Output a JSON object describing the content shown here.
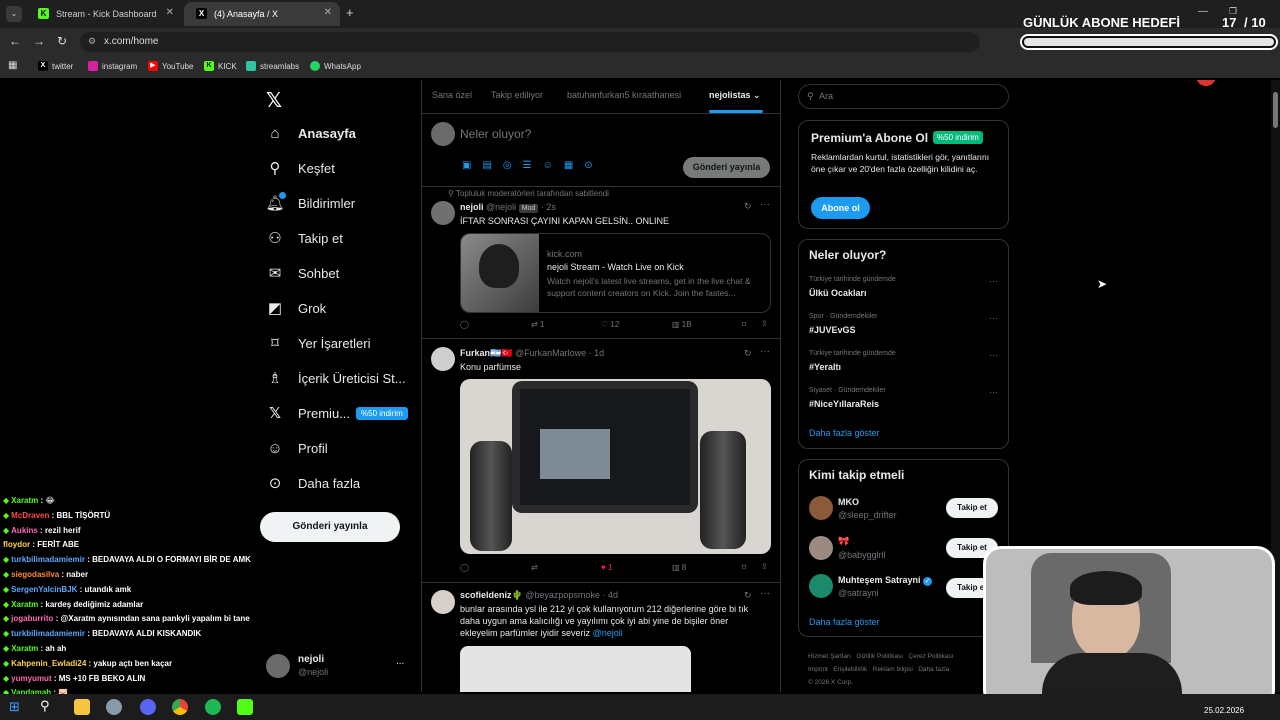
{
  "browser": {
    "tabs": [
      {
        "label": "Stream - Kick Dashboard",
        "favicon": "K",
        "active": false
      },
      {
        "label": "(4) Anasayfa / X",
        "favicon": "X",
        "active": true
      }
    ],
    "new_tab": "+",
    "url": "x.com/home",
    "bookmarks": [
      {
        "label": "twitter",
        "icon": "x-icon"
      },
      {
        "label": "instagram",
        "icon": "instagram-icon"
      },
      {
        "label": "YouTube",
        "icon": "youtube-icon"
      },
      {
        "label": "KICK",
        "icon": "kick-icon"
      },
      {
        "label": "streamlabs",
        "icon": "streamlabs-icon"
      },
      {
        "label": "WhatsApp",
        "icon": "whatsapp-icon"
      }
    ]
  },
  "overlay": {
    "goal_title": "GÜNLÜK ABONE HEDEFİ",
    "goal_current": "17",
    "goal_total": "/ 10",
    "goal_progress": 1.0
  },
  "sidebar": {
    "items": [
      {
        "label": "Anasayfa",
        "icon": "home-icon",
        "active": true
      },
      {
        "label": "Keşfet",
        "icon": "search-icon"
      },
      {
        "label": "Bildirimler",
        "icon": "bell-icon"
      },
      {
        "label": "Takip et",
        "icon": "add-user-icon"
      },
      {
        "label": "Sohbet",
        "icon": "mail-icon"
      },
      {
        "label": "Grok",
        "icon": "grok-icon"
      },
      {
        "label": "Yer İşaretleri",
        "icon": "bookmark-icon"
      },
      {
        "label": "İçerik Üreticisi St...",
        "icon": "creator-icon"
      },
      {
        "label": "Premiu...",
        "icon": "x-icon",
        "badge": "%50 indirim"
      },
      {
        "label": "Profil",
        "icon": "person-icon"
      },
      {
        "label": "Daha fazla",
        "icon": "more-icon"
      }
    ],
    "post_button": "Gönderi yayınla",
    "account_name": "nejoli",
    "account_handle": "@nejoli",
    "account_more": "..."
  },
  "feed": {
    "tabs": [
      "Sana özel",
      "Takip ediliyor",
      "batuhanfurkan5 kıraathanesi",
      "nejolistas"
    ],
    "active_tab": "nejolistas",
    "compose_placeholder": "Neler oluyor?",
    "compose_button": "Gönderi yayınla",
    "pinned_label": "Topluluk moderatörleri tarafından sabitlendi",
    "tweets": [
      {
        "name": "nejoli",
        "handle": "@nejoli",
        "badge": "Mod",
        "time": "· 2s",
        "text": "İFTAR SONRASI ÇAYINI KAPAN GELSİN.. ONLINE",
        "link_domain": "kick.com",
        "link_title": "nejoli Stream - Watch Live on Kick",
        "link_desc": "Watch nejoli's latest live streams, get in the live chat & support content creators on Kick. Join the fastes...",
        "reply": "",
        "retweet": "1",
        "like": "12",
        "views": "1B"
      },
      {
        "name": "Furkan🇦🇷🇹🇷",
        "handle": "@FurkanMarlowe",
        "time": "· 1d",
        "text": "Konu parfümse",
        "reply": "",
        "retweet": "",
        "like": "1",
        "views": "8"
      },
      {
        "name": "scofieldeniz🌵",
        "handle": "@beyazpopsmoke",
        "time": "· 4d",
        "text": "bunlar arasında ysl ile 212 yi çok kullanıyorum 212 diğerlerine göre bi tık daha uygun ama kalıcılığı ve yayılımı çok iyi abi yine de bişiler öner ekleyelim parfümler iyidir severiz",
        "mention": "@nejoli"
      }
    ]
  },
  "right": {
    "search_placeholder": "Ara",
    "premium": {
      "title": "Premium'a Abone Ol",
      "badge": "%50 indirim",
      "desc": "Reklamlardan kurtul, istatistikleri gör, yanıtlarını öne çıkar ve 20'den fazla özelliğin kilidini aç.",
      "button": "Abone ol"
    },
    "trends": {
      "title": "Neler oluyor?",
      "items": [
        {
          "category": "Türkiye tarihinde gündemde",
          "name": "Ülkü Ocakları"
        },
        {
          "category": "Spor · Gündemdekiler",
          "name": "#JUVEvGS"
        },
        {
          "category": "Türkiye tarihinde gündemde",
          "name": "#Yeraltı"
        },
        {
          "category": "Siyaset · Gündemdekiler",
          "name": "#NiceYıllaraReis"
        }
      ],
      "more": "Daha fazla göster"
    },
    "who_to_follow": {
      "title": "Kimi takip etmeli",
      "items": [
        {
          "name": "MKO",
          "handle": "@sleep_drifter",
          "button": "Takip et"
        },
        {
          "name": "🎀",
          "handle": "@babygglrll",
          "button": "Takip et"
        },
        {
          "name": "Muhteşem Satrayni",
          "handle": "@satrayni",
          "button": "Takip et",
          "verified": true
        }
      ],
      "more": "Daha fazla göster"
    },
    "footer": [
      "Hizmet Şartları",
      "Gizlilik Politikası",
      "Çerez Politikası",
      "Imprint",
      "Erişilebilirlik",
      "Reklam bilgisi",
      "Daha fazla",
      "© 2026 X Corp."
    ]
  },
  "chat": [
    {
      "user": "Xaratm",
      "color": "#53fc18",
      "msg": " : 😂"
    },
    {
      "user": "McDraven",
      "color": "#ff4b4b",
      "msg": " : BBL TİŞÖRTÜ"
    },
    {
      "user": "Aukins",
      "color": "#ff69b4",
      "msg": " : rezil herif"
    },
    {
      "user": "floydor",
      "color": "#ffd24b",
      "msg": " : FERİT ABE"
    },
    {
      "user": "turkbilimadamiemir",
      "color": "#5aa7ff",
      "msg": " : BEDAVAYA ALDI O FORMAYI BİR DE AMK"
    },
    {
      "user": "siegodasilva",
      "color": "#ff8a3d",
      "msg": " : naber"
    },
    {
      "user": "SergenYalcinBJK",
      "color": "#5aa7ff",
      "msg": " : utandık amk"
    },
    {
      "user": "Xaratm",
      "color": "#53fc18",
      "msg": " : kardeş dediğimiz adamlar"
    },
    {
      "user": "jogaburrito",
      "color": "#ff69b4",
      "msg": " : @Xaratm aynısından sana pankyli yapalım bi tane"
    },
    {
      "user": "turkbilimadamiemir",
      "color": "#5aa7ff",
      "msg": " : BEDAVAYA ALDI KISKANDIK"
    },
    {
      "user": "Xaratm",
      "color": "#53fc18",
      "msg": " : ah ah"
    },
    {
      "user": "Kahpenin_Ewladi24",
      "color": "#ffd24b",
      "msg": " : yakup açtı ben kaçar"
    },
    {
      "user": "yumyumut",
      "color": "#ff69b4",
      "msg": " : MS +10 FB BEKO ALIN"
    },
    {
      "user": "Vandamah",
      "color": "#53fc18",
      "msg": " : 🐷"
    }
  ],
  "taskbar": {
    "date": "25.02.2026"
  }
}
